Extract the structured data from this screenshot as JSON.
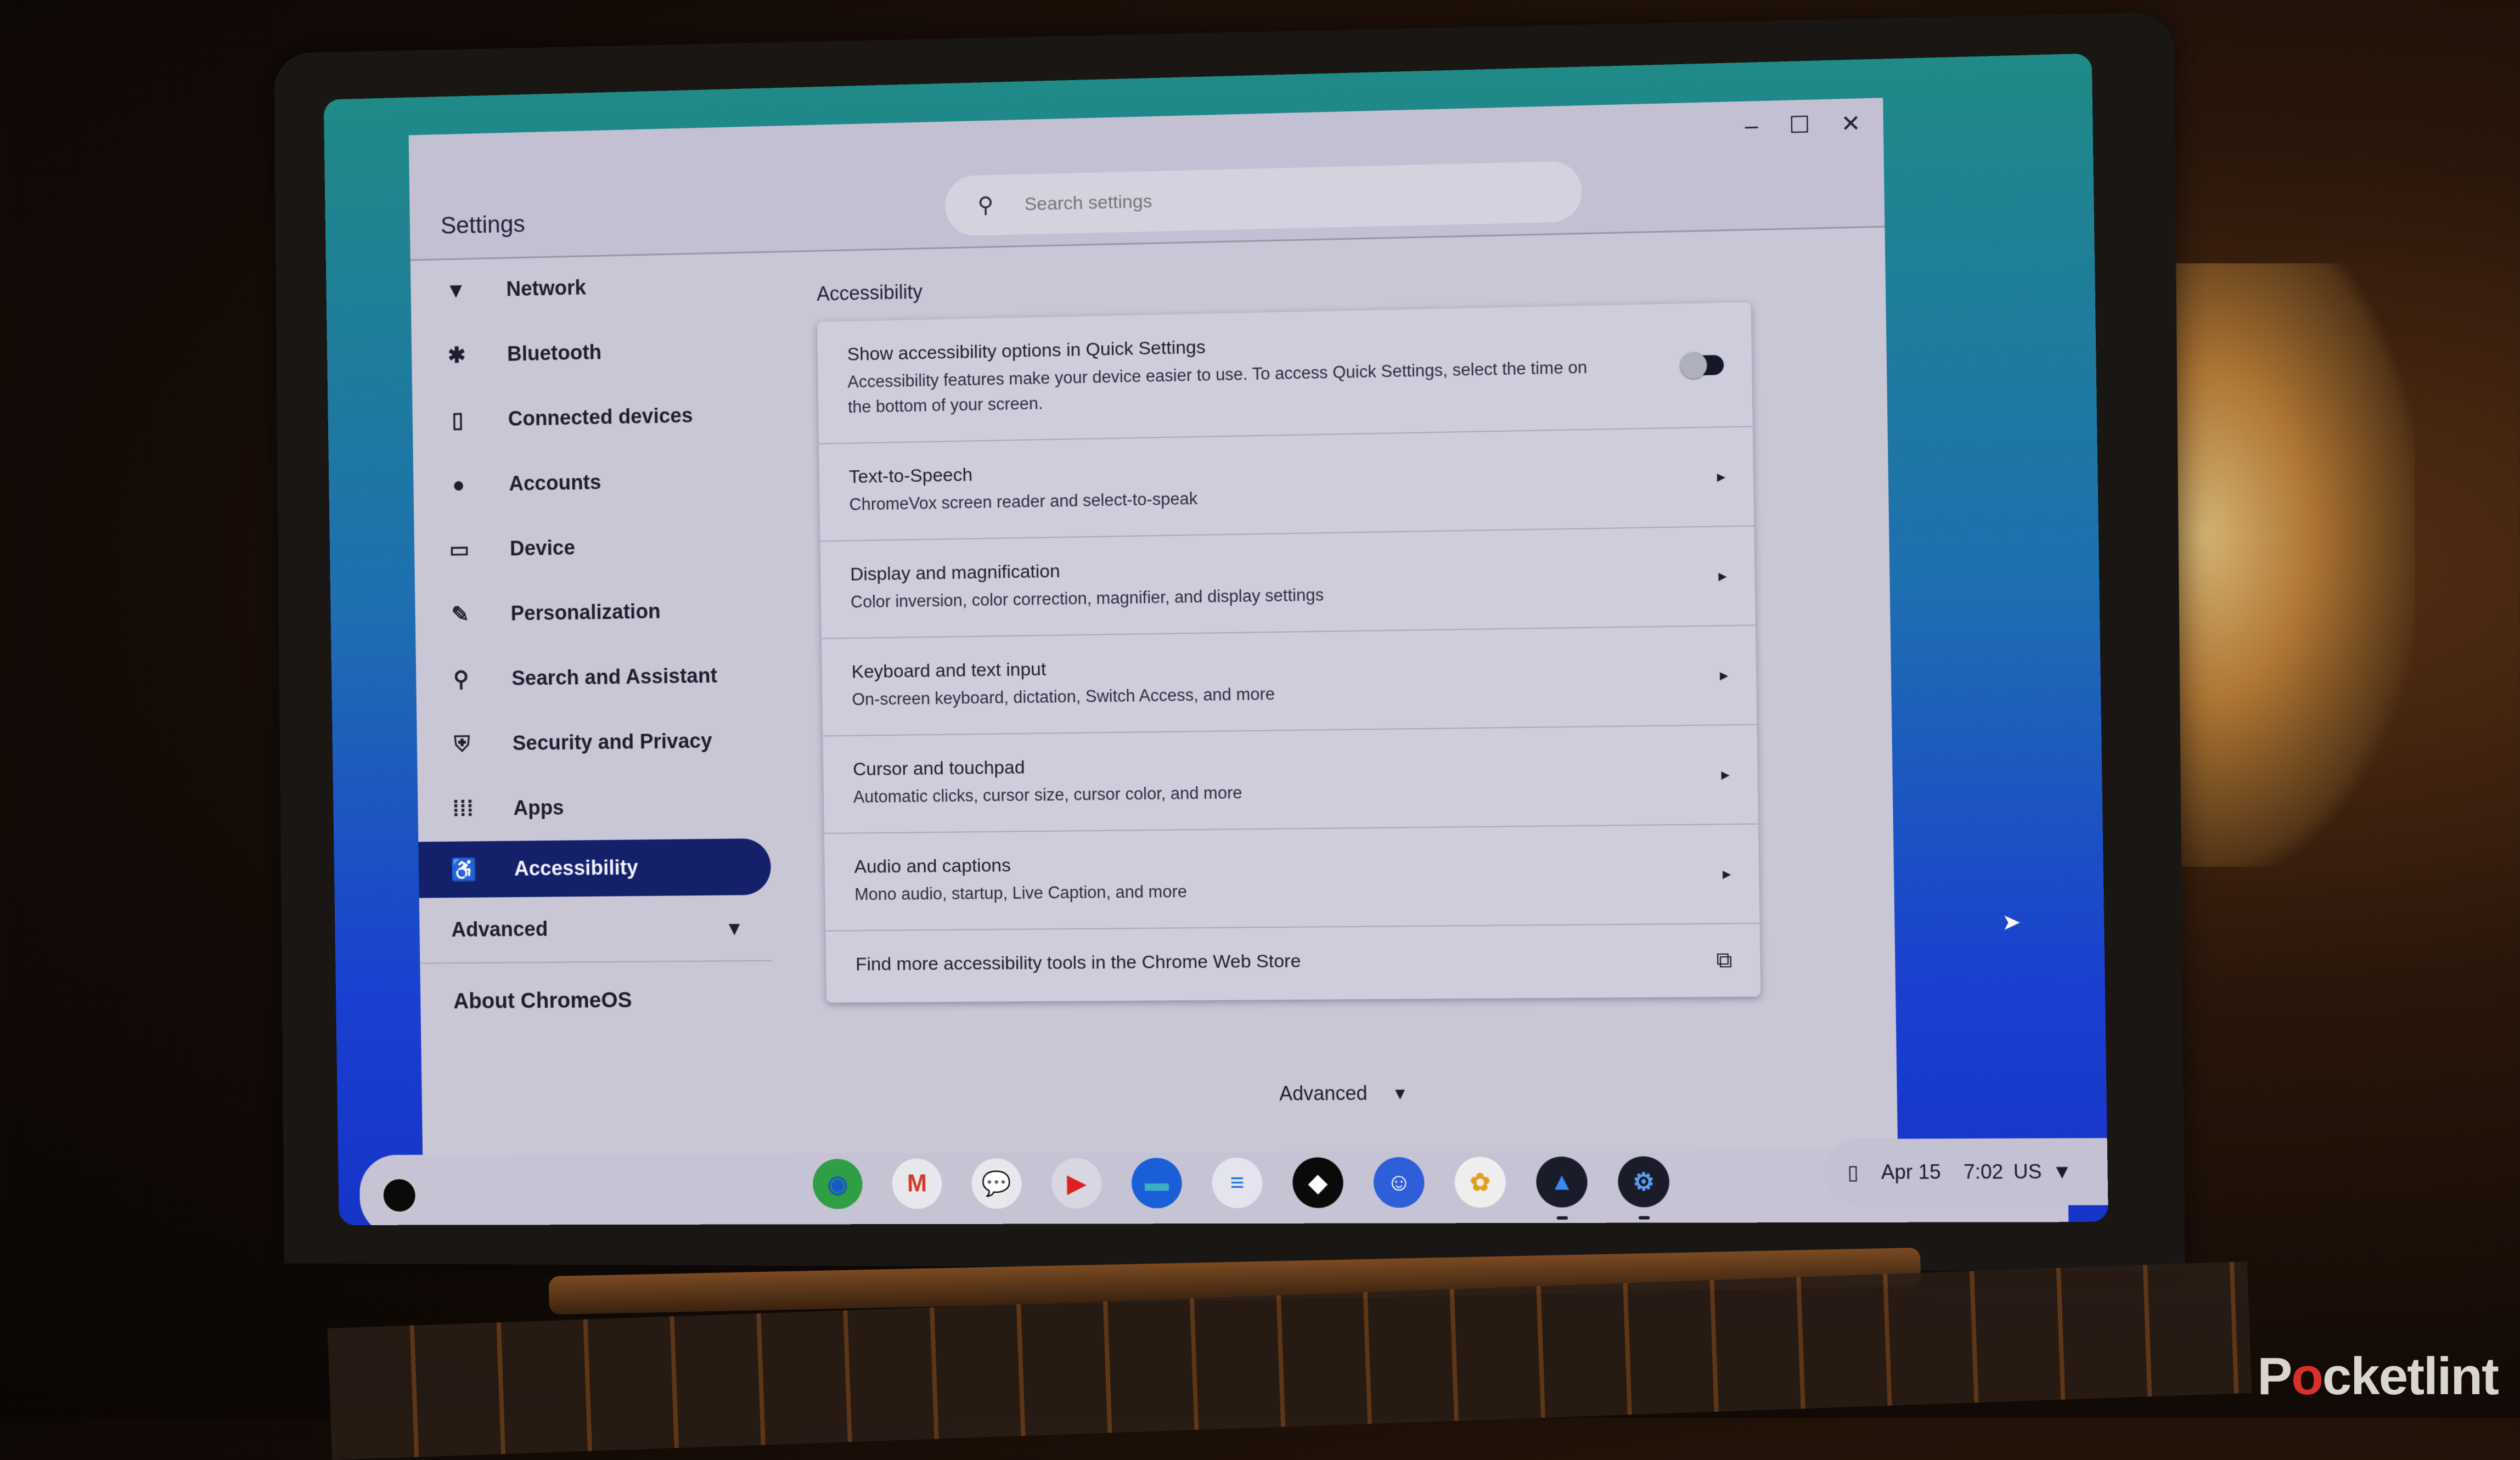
{
  "window": {
    "title": "Settings",
    "controls": {
      "minimize": "–",
      "maximize": "☐",
      "close": "✕"
    }
  },
  "search": {
    "placeholder": "Search settings",
    "value": ""
  },
  "sidebar": {
    "items": [
      {
        "label": "Network",
        "icon": "wifi-icon",
        "glyph": "▼"
      },
      {
        "label": "Bluetooth",
        "icon": "bluetooth-icon",
        "glyph": "✱"
      },
      {
        "label": "Connected devices",
        "icon": "phone-icon",
        "glyph": "▯"
      },
      {
        "label": "Accounts",
        "icon": "person-icon",
        "glyph": "●"
      },
      {
        "label": "Device",
        "icon": "laptop-icon",
        "glyph": "▭"
      },
      {
        "label": "Personalization",
        "icon": "brush-icon",
        "glyph": "✎"
      },
      {
        "label": "Search and Assistant",
        "icon": "search-icon",
        "glyph": "⚲"
      },
      {
        "label": "Security and Privacy",
        "icon": "shield-icon",
        "glyph": "⛨"
      },
      {
        "label": "Apps",
        "icon": "apps-grid-icon",
        "glyph": "⁞⁞⁞"
      },
      {
        "label": "Accessibility",
        "icon": "accessibility-icon",
        "glyph": "♿",
        "selected": true
      }
    ],
    "advanced": {
      "label": "Advanced",
      "chevron": "▾"
    },
    "about": "About ChromeOS"
  },
  "main": {
    "title": "Accessibility",
    "quick_settings": {
      "title": "Show accessibility options in Quick Settings",
      "description": "Accessibility features make your device easier to use. To access Quick Settings, select the time on the bottom of your screen.",
      "toggle_on": false
    },
    "rows": [
      {
        "title": "Text-to-Speech",
        "subtitle": "ChromeVox screen reader and select-to-speak"
      },
      {
        "title": "Display and magnification",
        "subtitle": "Color inversion, color correction, magnifier, and display settings"
      },
      {
        "title": "Keyboard and text input",
        "subtitle": "On-screen keyboard, dictation, Switch Access, and more"
      },
      {
        "title": "Cursor and touchpad",
        "subtitle": "Automatic clicks, cursor size, cursor color, and more"
      },
      {
        "title": "Audio and captions",
        "subtitle": "Mono audio, startup, Live Caption, and more"
      }
    ],
    "chevron": "▸",
    "web_store_link": "Find more accessibility tools in the Chrome Web Store",
    "external_icon": "⧉",
    "advanced": {
      "label": "Advanced",
      "chevron": "▾"
    }
  },
  "shelf": {
    "apps": [
      {
        "name": "Chrome",
        "glyph": "◉",
        "bg": "#2f9e44",
        "fg": "#1a57c8"
      },
      {
        "name": "Gmail",
        "glyph": "M",
        "bg": "#e8e8ec",
        "fg": "#d03a2a"
      },
      {
        "name": "Google Chat",
        "glyph": "💬",
        "bg": "#e8e8ec",
        "fg": "#1a73e8"
      },
      {
        "name": "YouTube",
        "glyph": "▶",
        "bg": "#d8d6e0",
        "fg": "#e02020"
      },
      {
        "name": "Files",
        "glyph": "▬",
        "bg": "#1a5fd8",
        "fg": "#3ab0c8"
      },
      {
        "name": "Docs",
        "glyph": "≡",
        "bg": "#e4e4ee",
        "fg": "#1a6fd8"
      },
      {
        "name": "Tidal",
        "glyph": "◆",
        "bg": "#0a0a0a",
        "fg": "#ffffff"
      },
      {
        "name": "Discord",
        "glyph": "☺",
        "bg": "#2f5fd8",
        "fg": "#ffffff"
      },
      {
        "name": "Google Photos",
        "glyph": "✿",
        "bg": "#eeeeee",
        "fg": "#e0a020"
      },
      {
        "name": "Gallery",
        "glyph": "▲",
        "bg": "#1a1c2a",
        "fg": "#3a8af0",
        "running": true
      },
      {
        "name": "Settings",
        "glyph": "⚙",
        "bg": "#1a1c2a",
        "fg": "#5aa0f0",
        "running": true
      }
    ],
    "status": {
      "phone_icon": "▯",
      "date": "Apr 15",
      "time": "7:02",
      "keyboard_layout": "US",
      "wifi_icon": "▼"
    }
  },
  "watermark": {
    "before": "P",
    "o": "o",
    "after": "cketlint"
  },
  "colors": {
    "selected_nav": "#15206a",
    "wallpaper_top": "#1f8a86",
    "wallpaper_bottom": "#1634c8",
    "window_bg": "#c9c6d6"
  }
}
